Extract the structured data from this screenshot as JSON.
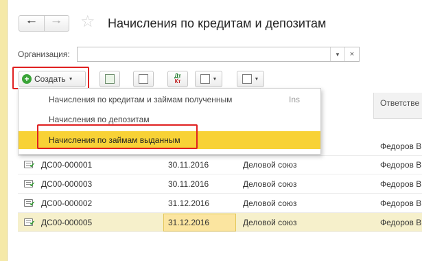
{
  "header": {
    "title": "Начисления по кредитам и депозитам",
    "back_icon": "arrow-left",
    "forward_icon": "arrow-right",
    "favorite_icon": "star"
  },
  "filter": {
    "org_label": "Организация:",
    "org_value": "",
    "dropdown_icon": "triangle-down",
    "clear_icon": "×"
  },
  "toolbar": {
    "create_label": "Создать",
    "dtkt_top": "Дт",
    "dtkt_bottom": "Кт"
  },
  "menu": {
    "items": [
      {
        "label": "Начисления по кредитам и займам полученным",
        "shortcut": "Ins"
      },
      {
        "label": "Начисления по депозитам",
        "shortcut": ""
      },
      {
        "label": "Начисления по займам выданным",
        "shortcut": ""
      }
    ]
  },
  "table": {
    "header_partial": "Ответстве",
    "rows": [
      {
        "number": "",
        "date": "",
        "org": "",
        "responsible": "Федоров В"
      },
      {
        "number": "ДС00-000001",
        "date": "30.11.2016",
        "org": "Деловой союз",
        "responsible": "Федоров В"
      },
      {
        "number": "ДС00-000003",
        "date": "30.11.2016",
        "org": "Деловой союз",
        "responsible": "Федоров В"
      },
      {
        "number": "ДС00-000002",
        "date": "31.12.2016",
        "org": "Деловой союз",
        "responsible": "Федоров В"
      },
      {
        "number": "ДС00-000005",
        "date": "31.12.2016",
        "org": "Деловой союз",
        "responsible": "Федоров В"
      }
    ]
  },
  "colors": {
    "accent_yellow": "#f8d236",
    "selected_row": "#f6f0cb",
    "highlight_red": "#e02020",
    "create_green": "#3aa438"
  }
}
